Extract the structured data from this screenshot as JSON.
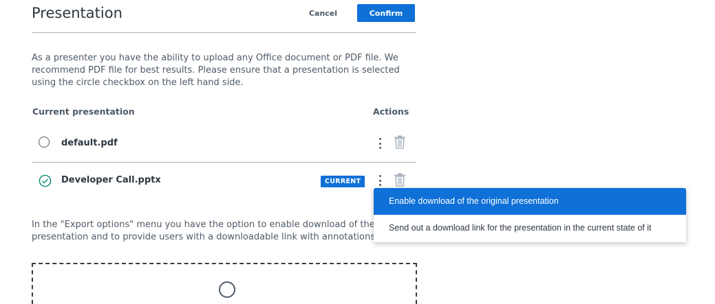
{
  "header": {
    "title": "Presentation",
    "cancel_label": "Cancel",
    "confirm_label": "Confirm"
  },
  "intro_text": "As a presenter you have the ability to upload any Office document or PDF file. We recommend PDF file for best results. Please ensure that a presentation is selected using the circle checkbox on the left hand side.",
  "table": {
    "col_current": "Current presentation",
    "col_actions": "Actions",
    "rows": [
      {
        "name": "default.pdf",
        "selected": false
      },
      {
        "name": "Developer Call.pptx",
        "selected": true,
        "badge": "CURRENT"
      }
    ]
  },
  "export_text": {
    "line1": "In the \"Export options\" menu you have the option to enable download of the original",
    "line2": "presentation and to provide users with a downloadable link with annotations in publi"
  },
  "menu": {
    "items": [
      "Enable download of the original presentation",
      "Send out a download link for the presentation in the current state of it"
    ]
  },
  "colors": {
    "accent": "#0f70d7",
    "text": "#4e5a66",
    "divider": "#a9b3bd"
  },
  "icons": [
    "radio-icon",
    "check-circle-icon",
    "more-vert-icon",
    "trash-icon",
    "upload-icon"
  ]
}
